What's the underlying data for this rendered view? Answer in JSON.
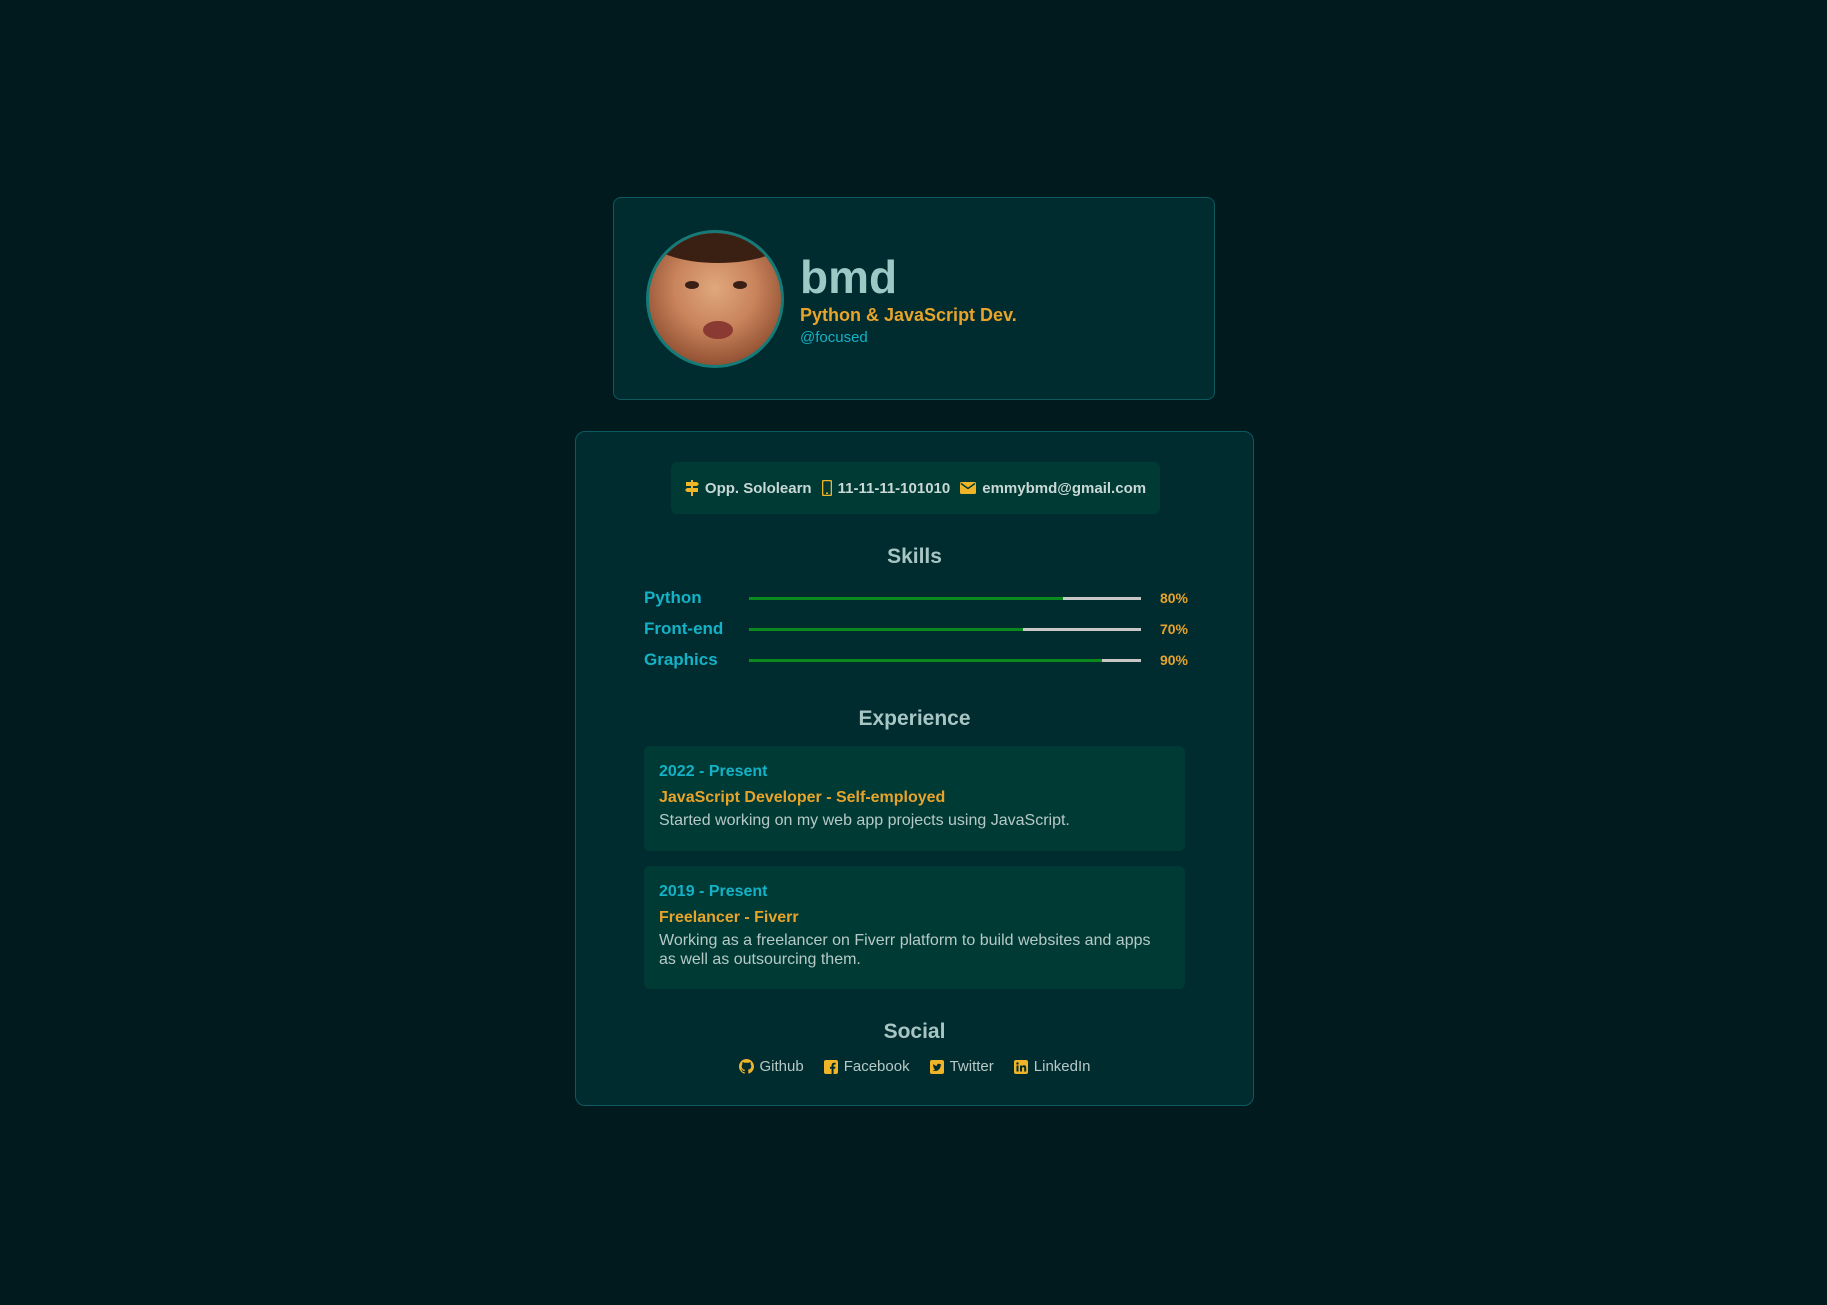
{
  "profile": {
    "name": "bmd",
    "title": "Python & JavaScript Dev.",
    "handle": "@focused"
  },
  "contact": {
    "location": "Opp. Sololearn",
    "phone": "11-11-11-101010",
    "email": "emmybmd@gmail.com"
  },
  "sections": {
    "skills": "Skills",
    "experience": "Experience",
    "social": "Social"
  },
  "skills": [
    {
      "label": "Python",
      "percent_text": "80%",
      "level": 0.8
    },
    {
      "label": "Front-end",
      "percent_text": "70%",
      "level": 0.7
    },
    {
      "label": "Graphics",
      "percent_text": "90%",
      "level": 0.9
    }
  ],
  "experience": [
    {
      "when": "2022 - Present",
      "role": "JavaScript Developer - Self-employed",
      "desc": "Started working on my web app projects using JavaScript."
    },
    {
      "when": "2019 - Present",
      "role": "Freelancer - Fiverr",
      "desc": "Working as a freelancer on Fiverr platform to build websites and apps as well as outsourcing them."
    }
  ],
  "social": [
    {
      "label": "Github",
      "icon": "github-icon"
    },
    {
      "label": "Facebook",
      "icon": "facebook-icon"
    },
    {
      "label": "Twitter",
      "icon": "twitter-icon"
    },
    {
      "label": "LinkedIn",
      "icon": "linkedin-icon"
    }
  ],
  "colors": {
    "background": "#001a1e",
    "card": "#002b2f",
    "accent": "#e8a42a",
    "teal": "#14b2c6",
    "bar_fill": "#0a8a1c",
    "bar_track": "#c7c7c7"
  }
}
